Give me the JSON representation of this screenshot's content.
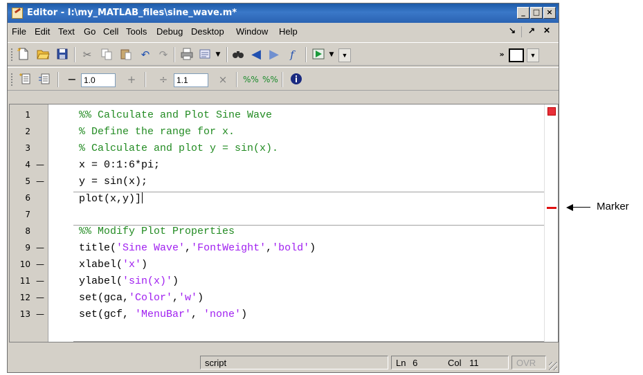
{
  "window": {
    "title": "Editor - I:\\my_MATLAB_files\\sine_wave.m*",
    "minimize_glyph": "_",
    "maximize_glyph": "□",
    "close_glyph": "×"
  },
  "menu": {
    "items": [
      "File",
      "Edit",
      "Text",
      "Go",
      "Cell",
      "Tools",
      "Debug",
      "Desktop",
      "Window",
      "Help"
    ],
    "dock_glyph": "↘",
    "undock_glyph": "↗",
    "close_glyph": "✕"
  },
  "toolbar1": {
    "icons": [
      "new-file-icon",
      "open-folder-icon",
      "save-icon",
      "cut-icon",
      "copy-icon",
      "paste-icon",
      "undo-icon",
      "redo-icon",
      "print-icon",
      "page-setup-icon",
      "find-icon",
      "back-icon",
      "forward-icon",
      "function-icon",
      "run-icon",
      "stack-dropdown-icon",
      "more-icon",
      "layout-icon"
    ]
  },
  "toolbar2": {
    "decrement_symbol": "−",
    "decrement_value": "1.0",
    "increment_symbol": "+",
    "divide_symbol": "÷",
    "divide_value": "1.1",
    "multiply_symbol": "×"
  },
  "editor": {
    "lines": [
      {
        "num": "1",
        "dash": "",
        "segments": [
          {
            "t": "%% Calculate and Plot Sine Wave",
            "c": "cmt"
          }
        ]
      },
      {
        "num": "2",
        "dash": "",
        "segments": [
          {
            "t": "% Define the range for x.",
            "c": "cmt"
          }
        ]
      },
      {
        "num": "3",
        "dash": "",
        "segments": [
          {
            "t": "% Calculate and plot y = sin(x).",
            "c": "cmt"
          }
        ]
      },
      {
        "num": "4",
        "dash": "—",
        "segments": [
          {
            "t": "x = 0:1:6*pi;",
            "c": ""
          }
        ]
      },
      {
        "num": "5",
        "dash": "—",
        "segments": [
          {
            "t": "y = sin(x);",
            "c": ""
          }
        ]
      },
      {
        "num": "6",
        "dash": "",
        "segments": [
          {
            "t": "plot(x,y)]",
            "c": ""
          }
        ]
      },
      {
        "num": "7",
        "dash": "",
        "segments": [
          {
            "t": "",
            "c": ""
          }
        ]
      },
      {
        "num": "8",
        "dash": "",
        "segments": [
          {
            "t": "%% Modify Plot Properties",
            "c": "cmt"
          }
        ]
      },
      {
        "num": "9",
        "dash": "—",
        "segments": [
          {
            "t": "title(",
            "c": ""
          },
          {
            "t": "'Sine Wave'",
            "c": "str"
          },
          {
            "t": ",",
            "c": ""
          },
          {
            "t": "'FontWeight'",
            "c": "str"
          },
          {
            "t": ",",
            "c": ""
          },
          {
            "t": "'bold'",
            "c": "str"
          },
          {
            "t": ")",
            "c": ""
          }
        ]
      },
      {
        "num": "10",
        "dash": "—",
        "segments": [
          {
            "t": "xlabel(",
            "c": ""
          },
          {
            "t": "'x'",
            "c": "str"
          },
          {
            "t": ")",
            "c": ""
          }
        ]
      },
      {
        "num": "11",
        "dash": "—",
        "segments": [
          {
            "t": "ylabel(",
            "c": ""
          },
          {
            "t": "'sin(x)'",
            "c": "str"
          },
          {
            "t": ")",
            "c": ""
          }
        ]
      },
      {
        "num": "12",
        "dash": "—",
        "segments": [
          {
            "t": "set(gca,",
            "c": ""
          },
          {
            "t": "'Color'",
            "c": "str"
          },
          {
            "t": ",",
            "c": ""
          },
          {
            "t": "'w'",
            "c": "str"
          },
          {
            "t": ")",
            "c": ""
          }
        ]
      },
      {
        "num": "13",
        "dash": "—",
        "segments": [
          {
            "t": "set(gcf, ",
            "c": ""
          },
          {
            "t": "'MenuBar'",
            "c": "str"
          },
          {
            "t": ", ",
            "c": ""
          },
          {
            "t": "'none'",
            "c": "str"
          },
          {
            "t": ")",
            "c": ""
          }
        ]
      }
    ],
    "status_indicator_color": "#e8303a",
    "marker_color": "#e01010"
  },
  "statusbar": {
    "mode": "script",
    "ln_label": "Ln",
    "ln_value": "6",
    "col_label": "Col",
    "col_value": "11",
    "ovr": "OVR"
  },
  "annotation": {
    "label": "Marker"
  }
}
